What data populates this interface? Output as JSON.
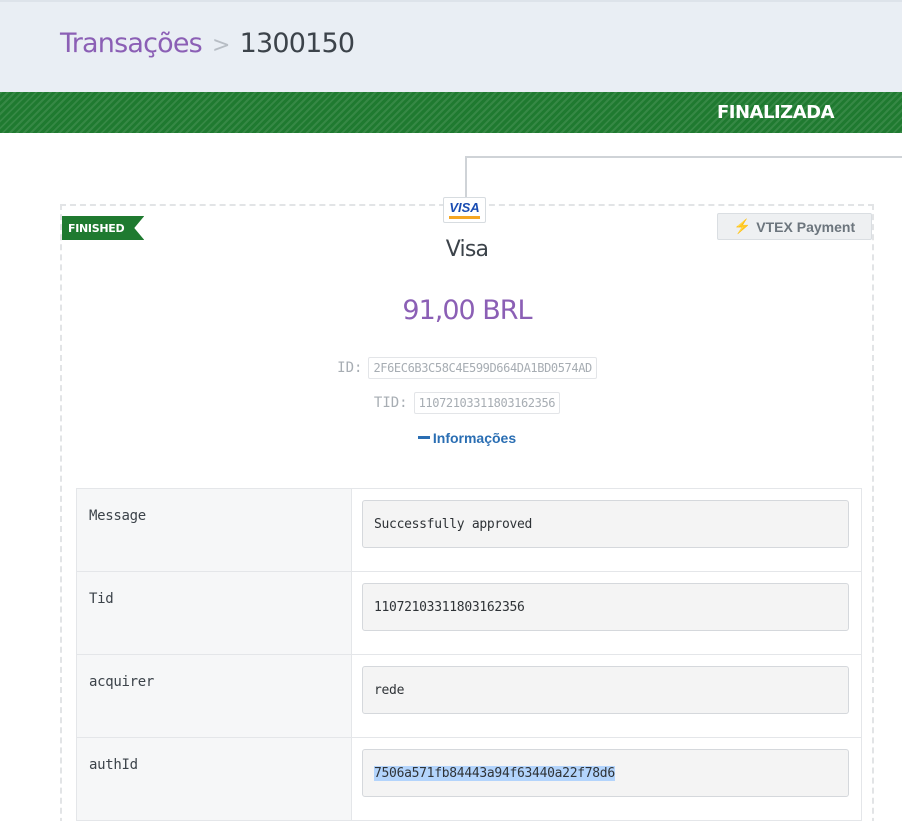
{
  "breadcrumb": {
    "parent": "Transações",
    "separator": ">",
    "current": "1300150"
  },
  "status_bar": {
    "label": "FINALIZADA",
    "color": "#1f7a30"
  },
  "payment": {
    "status_flag": "FINISHED",
    "connector_badge": "VTEX Payment",
    "connector_icon": "plug-icon",
    "card_brand_logo": "VISA",
    "method": "Visa",
    "amount": "91,00 BRL",
    "id_label": "ID:",
    "id_value": "2F6EC6B3C58C4E599D664DA1BD0574AD",
    "tid_label": "TID:",
    "tid_value": "11072103311803162356",
    "info_toggle": "Informações"
  },
  "details": [
    {
      "key": "Message",
      "value": "Successfully approved"
    },
    {
      "key": "Tid",
      "value": "11072103311803162356"
    },
    {
      "key": "acquirer",
      "value": "rede"
    },
    {
      "key": "authId",
      "value": "7506a571fb84443a94f63440a22f78d6"
    }
  ],
  "colors": {
    "accent_purple": "#8b5fb5",
    "link_blue": "#2a6eb3",
    "success_green": "#1f7a30"
  }
}
